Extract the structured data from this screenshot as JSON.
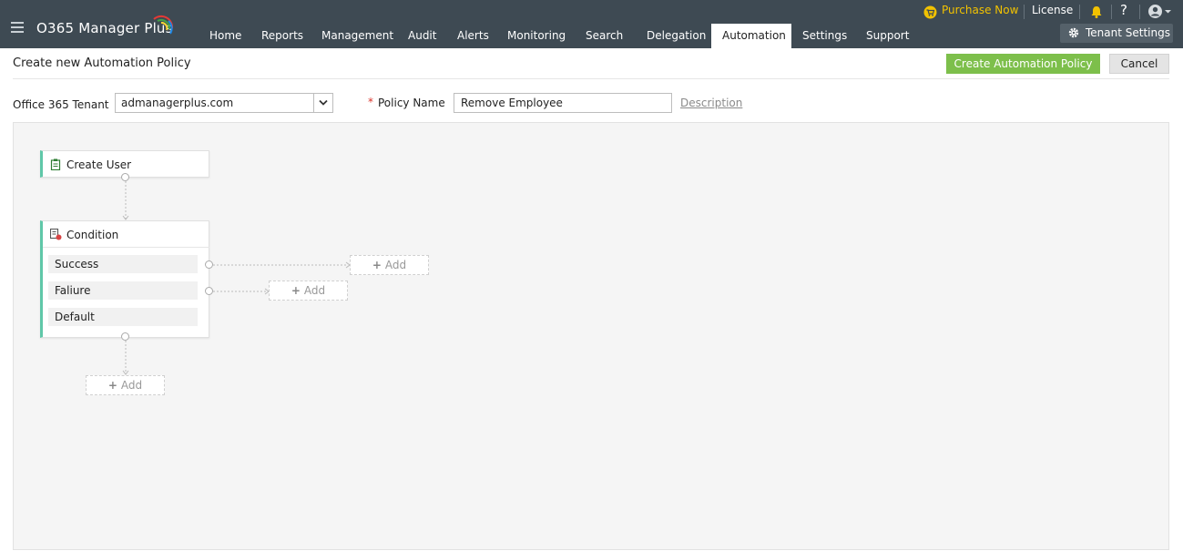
{
  "app": {
    "logo_text": "O365 Manager Plus"
  },
  "nav": {
    "items": [
      "Home",
      "Reports",
      "Management",
      "Audit",
      "Alerts",
      "Monitoring",
      "Search",
      "Delegation",
      "Automation",
      "Settings",
      "Support"
    ],
    "active": "Automation"
  },
  "utility": {
    "purchase_label": "Purchase Now",
    "license_label": "License",
    "help_label": "?",
    "tenant_settings_label": "Tenant Settings"
  },
  "page": {
    "title": "Create new Automation Policy",
    "create_button": "Create Automation Policy",
    "cancel_button": "Cancel"
  },
  "form": {
    "tenant_label": "Office 365 Tenant",
    "tenant_value": "admanagerplus.com",
    "required_mark": "*",
    "policy_label": "Policy Name",
    "policy_value": "Remove Employee",
    "description_link": "Description"
  },
  "workflow": {
    "trigger_node": "Create User",
    "condition_node": "Condition",
    "conditions": [
      "Success",
      "Faliure",
      "Default"
    ],
    "add_label": "Add"
  },
  "colors": {
    "topbar": "#3e4a53",
    "accent_green": "#7dbf4b",
    "purchase_yellow": "#f2c200",
    "node_border": "#5fc7a8"
  },
  "icons": {
    "menu": "hamburger-icon",
    "cart": "cart-icon",
    "bell": "bell-icon",
    "user": "user-icon",
    "gear": "gear-icon",
    "dropdown": "chevron-down-icon",
    "trigger": "clipboard-icon",
    "condition": "condition-icon",
    "add": "plus-icon"
  }
}
